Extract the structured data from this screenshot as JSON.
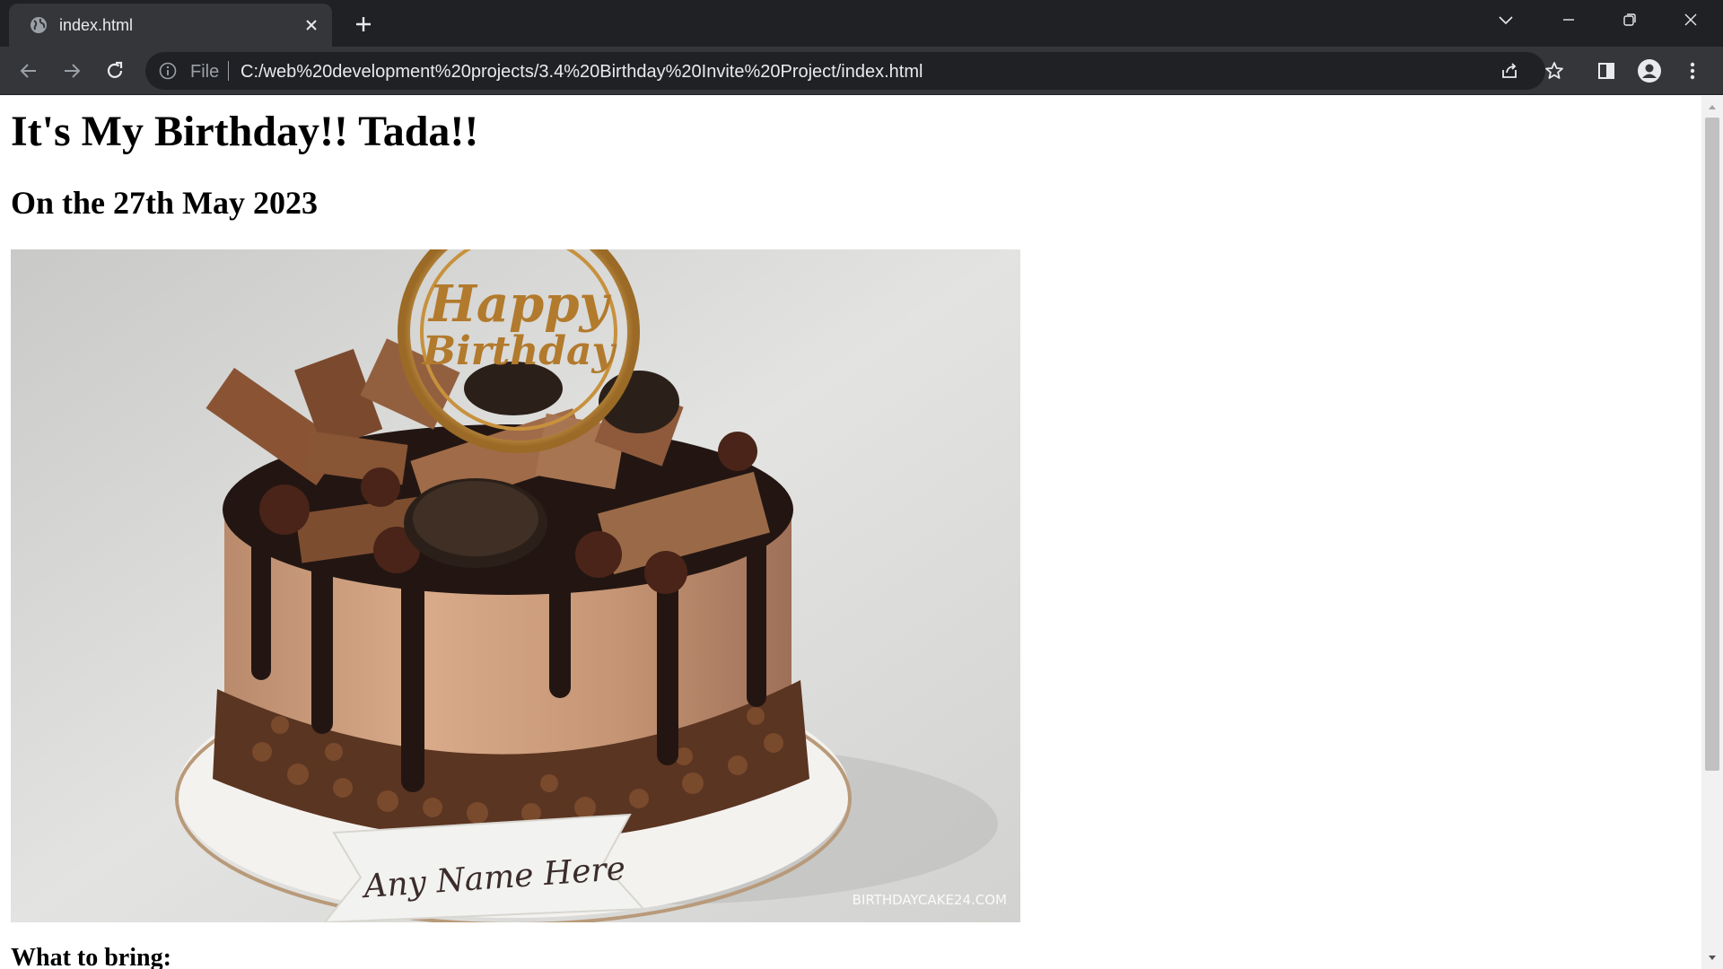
{
  "browser": {
    "tab": {
      "title": "index.html",
      "favicon": "globe-icon",
      "close_icon": "close-icon"
    },
    "new_tab_icon": "plus-icon",
    "window_controls": [
      "chevron-down-icon",
      "minimize-icon",
      "restore-icon",
      "close-icon"
    ],
    "address_bar": {
      "scheme_label": "File",
      "url": "C:/web%20development%20projects/3.4%20Birthday%20Invite%20Project/index.html"
    },
    "toolbar_icons": [
      "back-icon",
      "forward-icon",
      "reload-icon",
      "info-icon",
      "share-icon",
      "star-icon",
      "side-panel-icon",
      "profile-icon",
      "more-icon"
    ],
    "colors": {
      "chrome_dark": "#202124",
      "chrome_mid": "#35363a",
      "text_light": "#e8eaed",
      "text_muted": "#9aa0a6"
    }
  },
  "page": {
    "heading": "It's My Birthday!! Tada!!",
    "date_heading": "On the 27th May 2023",
    "cake_image": {
      "topper_text_1": "Happy",
      "topper_text_2": "Birthday",
      "banner_text": "Any Name Here",
      "watermark": "BIRTHDAYCAKE24.COM"
    },
    "next_heading": "What to bring:"
  }
}
